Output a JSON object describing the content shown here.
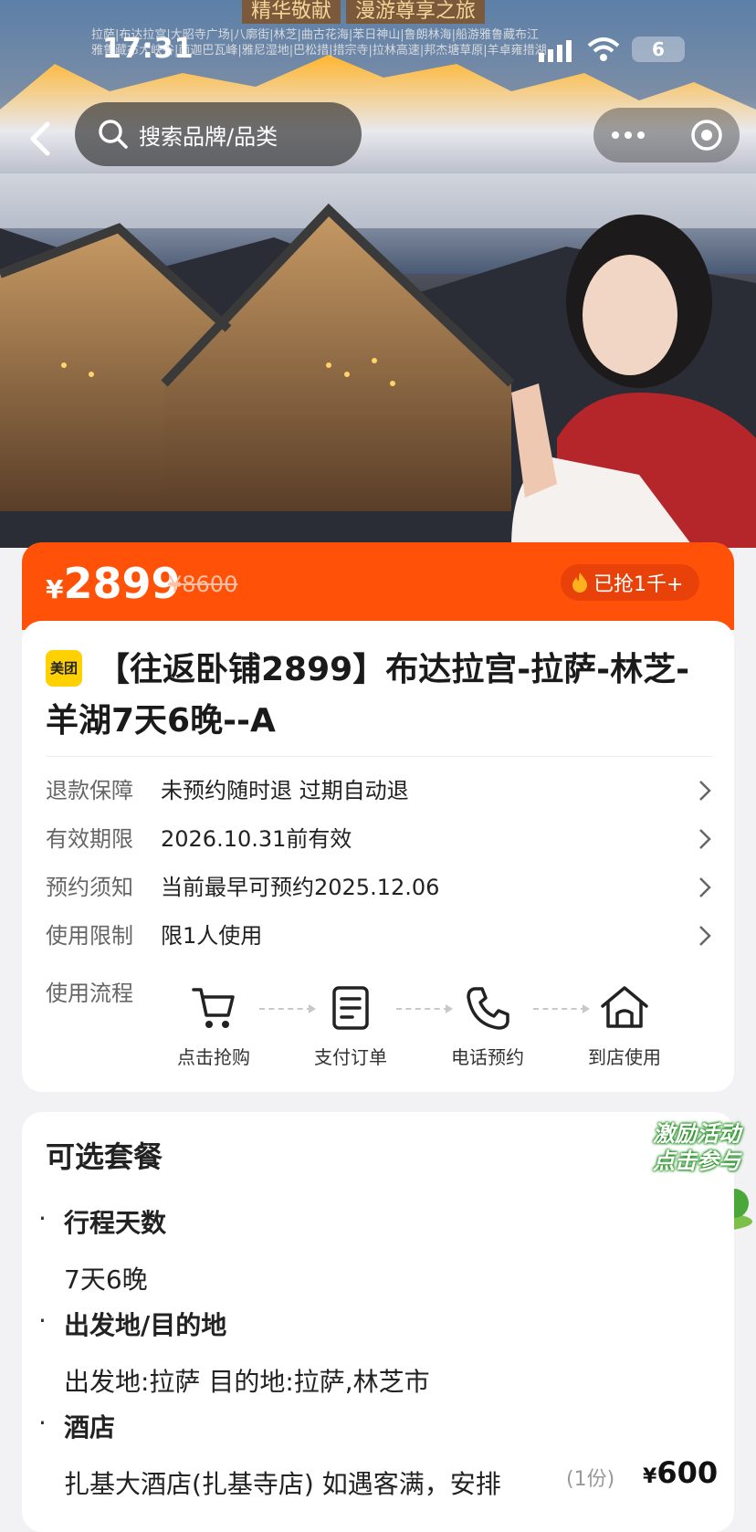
{
  "banner": {
    "title_left": "精华敬献",
    "title_right": "漫游尊享之旅",
    "tags_line1": "拉萨|布达拉宫|大昭寺广场|八廓街|林芝|曲古花海|苯日神山|鲁朗林海|船游雅鲁藏布江",
    "tags_line2": "雅鲁藏布大峡谷|南迦巴瓦峰|雅尼湿地|巴松措|措宗寺|拉林高速|邦杰塘草原|羊卓雍措湖"
  },
  "status_bar": {
    "time": "17:31",
    "battery": "6"
  },
  "nav": {
    "search_placeholder": "搜索品牌/品类"
  },
  "price_bar": {
    "currency": "¥",
    "price": "2899",
    "original_price": "¥8600",
    "sold_text": "已抢1千+"
  },
  "product": {
    "brand_badge": "美团",
    "title": "【往返卧铺2899】布达拉宫-拉萨-林芝-羊湖7天6晚--A"
  },
  "info_rows": [
    {
      "key": "退款保障",
      "value": "未预约随时退 过期自动退"
    },
    {
      "key": "有效期限",
      "value": "2026.10.31前有效"
    },
    {
      "key": "预约须知",
      "value": "当前最早可预约2025.12.06"
    },
    {
      "key": "使用限制",
      "value": "限1人使用"
    }
  ],
  "flow": {
    "label": "使用流程",
    "steps": [
      {
        "icon": "cart-icon",
        "label": "点击抢购"
      },
      {
        "icon": "order-icon",
        "label": "支付订单"
      },
      {
        "icon": "phone-icon",
        "label": "电话预约"
      },
      {
        "icon": "store-icon",
        "label": "到店使用"
      }
    ]
  },
  "packages": {
    "title": "可选套餐",
    "sections": [
      {
        "heading": "行程天数",
        "value": "7天6晚"
      },
      {
        "heading": "出发地/目的地",
        "value": "出发地:拉萨 目的地:拉萨,林芝市"
      },
      {
        "heading": "酒店",
        "value": "扎基大酒店(扎基寺店) 如遇客满，安排"
      }
    ],
    "qty": "(1份)",
    "item_currency": "¥",
    "item_price": "600"
  },
  "promo": {
    "line1": "激励活动",
    "line2": "点击参与"
  },
  "colors": {
    "accent": "#ff5208",
    "brand_yellow": "#ffd100"
  }
}
